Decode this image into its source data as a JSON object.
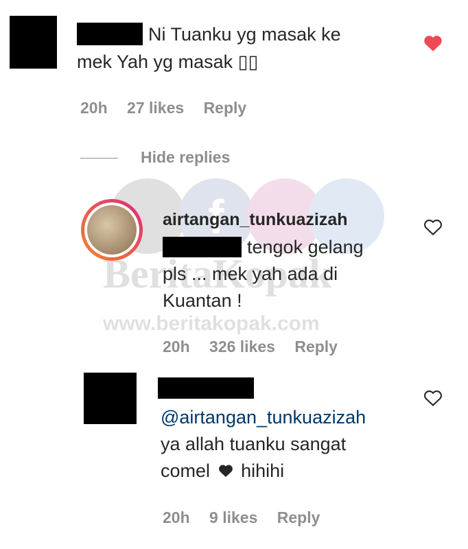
{
  "comment": {
    "text_line1": "Ni Tuanku yg masak ke",
    "text_line2": "mek Yah yg masak ▯▯",
    "time": "20h",
    "likes": "27 likes",
    "reply_label": "Reply",
    "liked": true
  },
  "hide_replies_label": "Hide replies",
  "reply1": {
    "username": "airtangan_tunkuazizah",
    "text_line1": "tengok gelang",
    "text_line2": "pls ... mek yah ada di",
    "text_line3": "Kuantan !",
    "time": "20h",
    "likes": "326 likes",
    "reply_label": "Reply"
  },
  "reply2": {
    "mention": "@airtangan_tunkuazizah",
    "text_line1": "ya allah tuanku sangat",
    "text_line2_a": "comel",
    "text_line2_b": "hihihi",
    "time": "20h",
    "likes": "9 likes",
    "reply_label": "Reply"
  },
  "watermark": {
    "brand": "BeritaKopak",
    "url": "www.beritakopak.com"
  },
  "colors": {
    "liked_heart": "#ed4956",
    "meta_gray": "#8e8e8e",
    "mention_blue": "#00376b",
    "story_ring_start": "#f58529",
    "story_ring_end": "#dd2a7b"
  }
}
